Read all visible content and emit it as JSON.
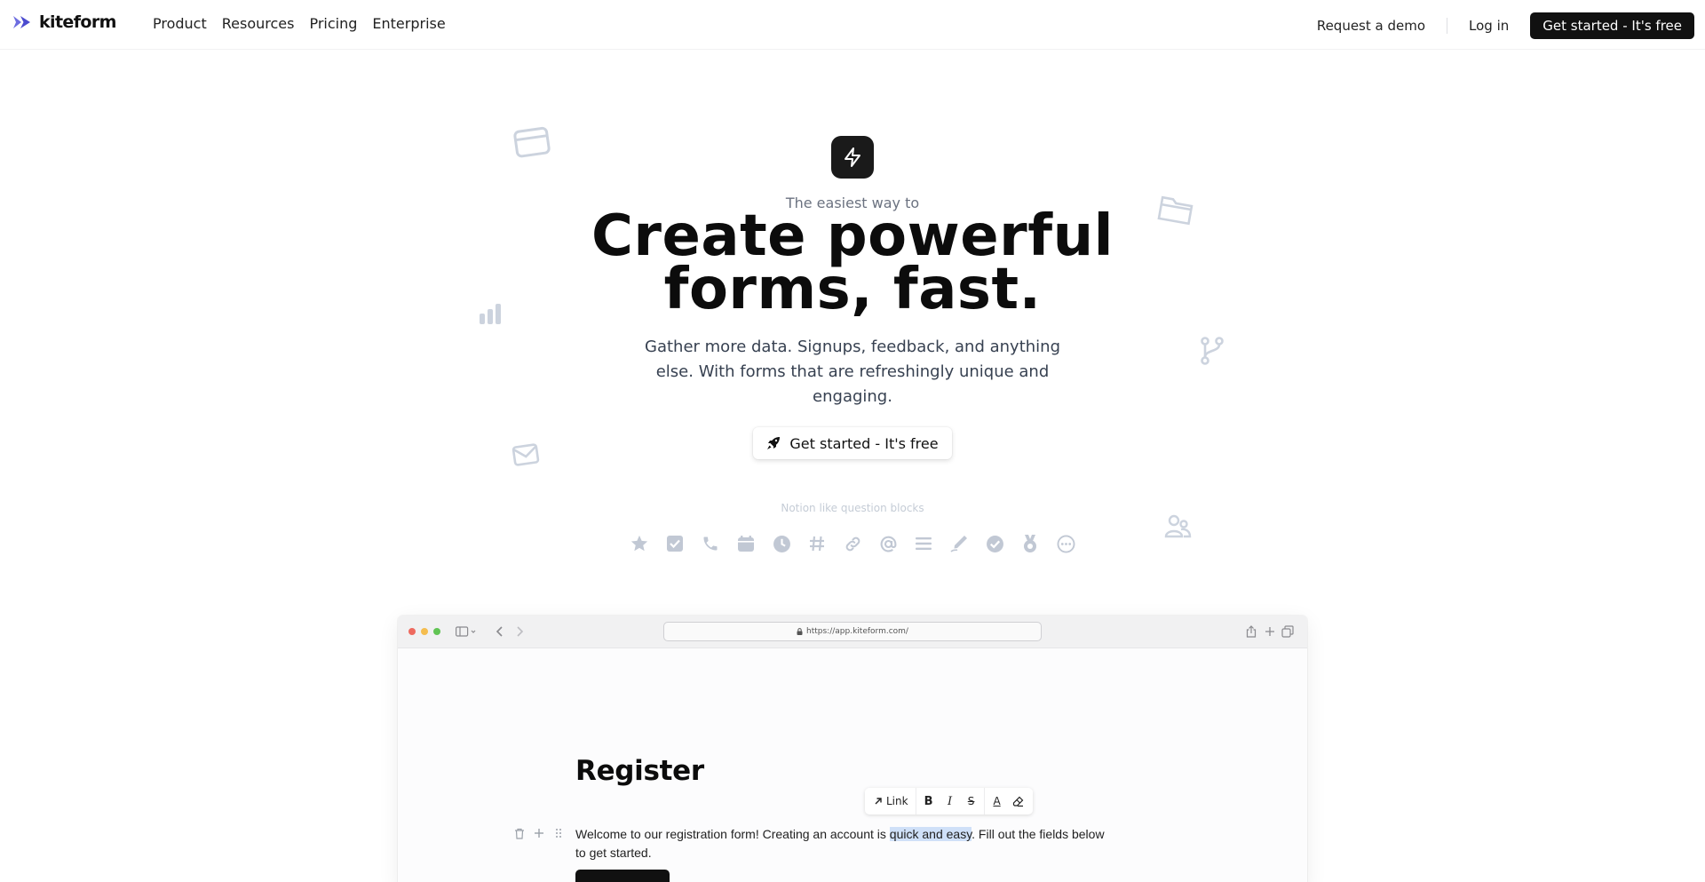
{
  "nav": {
    "logo_text": "kiteform",
    "links": [
      "Product",
      "Resources",
      "Pricing",
      "Enterprise"
    ],
    "request_demo": "Request a demo",
    "login": "Log in",
    "cta": "Get started - It's free"
  },
  "hero": {
    "eyebrow": "The easiest way to",
    "title_line1": "Create powerful",
    "title_line2": "forms, fast.",
    "subtitle": "Gather more data. Signups, feedback, and anything else. With forms that are refreshingly unique and engaging.",
    "cta": "Get started - It's free",
    "question_blocks_label": "Notion like question blocks",
    "question_block_icons": [
      "star-icon",
      "checkbox-icon",
      "phone-icon",
      "calendar-icon",
      "clock-icon",
      "hash-icon",
      "link-icon",
      "at-sign-icon",
      "list-icon",
      "signature-icon",
      "check-circle-icon",
      "medal-icon",
      "more-icon"
    ]
  },
  "browser": {
    "url": "https://app.kiteform.com/",
    "form": {
      "title": "Register",
      "text_before": "Welcome to our registration form! Creating an account is ",
      "text_highlight": "quick and easy",
      "text_after": ". Fill out the fields below to get started."
    },
    "toolbar": {
      "link_label": "Link",
      "bold": "B",
      "italic": "I",
      "strike": "S",
      "text_color": "A"
    }
  },
  "colors": {
    "brand_mark": "#5b5bd6",
    "cta_background": "#111111",
    "muted_icon": "#c1c8d4",
    "selection": "#cfe0f8",
    "traffic_red": "#ee6a5f",
    "traffic_yellow": "#f5bd4f",
    "traffic_green": "#61c454"
  }
}
